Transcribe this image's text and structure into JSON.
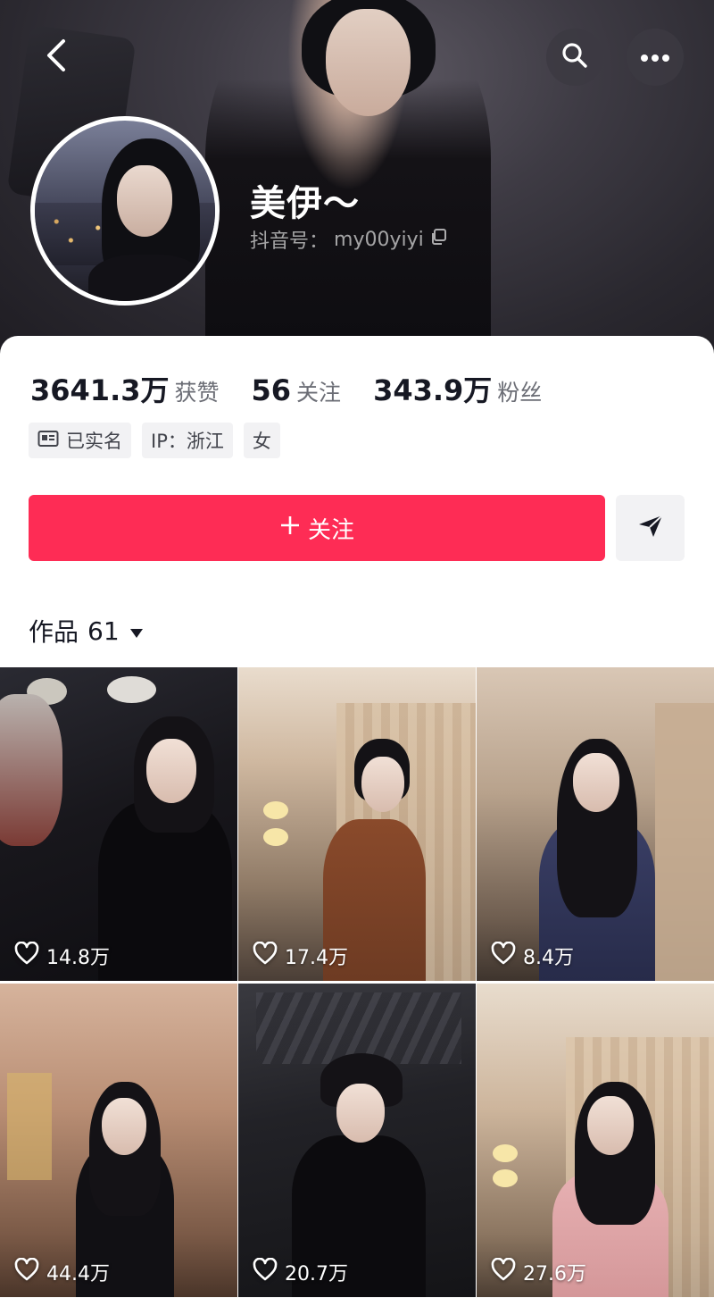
{
  "profile": {
    "nickname": "美伊～",
    "douyin_id_label": "抖音号：",
    "douyin_id": "my00yiyi"
  },
  "stats": [
    {
      "value": "3641.3万",
      "label": "获赞"
    },
    {
      "value": "56",
      "label": "关注"
    },
    {
      "value": "343.9万",
      "label": "粉丝"
    }
  ],
  "tags": {
    "verified": "已实名",
    "ip": "IP：浙江",
    "gender": "女"
  },
  "actions": {
    "follow_label": "关注",
    "follow_color": "#fe2c55"
  },
  "works": {
    "tab_label": "作品",
    "count": "61"
  },
  "videos": [
    {
      "likes": "14.8万"
    },
    {
      "likes": "17.4万"
    },
    {
      "likes": "8.4万"
    },
    {
      "likes": "44.4万"
    },
    {
      "likes": "20.7万"
    },
    {
      "likes": "27.6万"
    }
  ],
  "icons": {
    "back": "chevron-left-icon",
    "search": "search-icon",
    "more": "more-dots-icon",
    "copy": "copy-icon",
    "id_card": "id-card-icon",
    "share": "send-icon",
    "dropdown": "triangle-down-icon",
    "like": "heart-icon"
  }
}
